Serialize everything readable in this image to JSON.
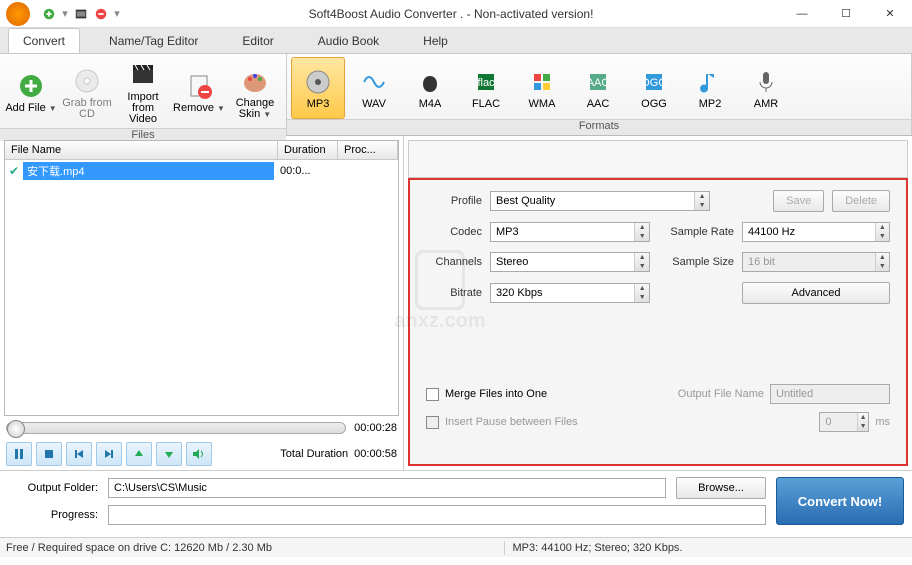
{
  "title": "Soft4Boost Audio Converter  . - Non-activated version!",
  "tabs": [
    "Convert",
    "Name/Tag Editor",
    "Editor",
    "Audio Book",
    "Help"
  ],
  "ribbon": {
    "files_label": "Files",
    "formats_label": "Formats",
    "files": [
      {
        "label": "Add\nFile",
        "drop": true
      },
      {
        "label": "Grab\nfrom CD",
        "disabled": true
      },
      {
        "label": "Import\nfrom Video"
      },
      {
        "label": "Remove",
        "drop": true
      },
      {
        "label": "Change\nSkin",
        "drop": true
      }
    ],
    "formats": [
      {
        "label": "MP3",
        "selected": true
      },
      {
        "label": "WAV"
      },
      {
        "label": "M4A"
      },
      {
        "label": "FLAC"
      },
      {
        "label": "WMA"
      },
      {
        "label": "AAC"
      },
      {
        "label": "OGG"
      },
      {
        "label": "MP2"
      },
      {
        "label": "AMR"
      }
    ]
  },
  "file_table": {
    "cols": [
      "File Name",
      "Duration",
      "Proc..."
    ],
    "rows": [
      {
        "name": "安下载.mp4",
        "duration": "00:0...",
        "proc": ""
      }
    ]
  },
  "player": {
    "elapsed": "00:00:28",
    "total_label": "Total Duration",
    "total": "00:00:58"
  },
  "settings": {
    "profile_label": "Profile",
    "profile": "Best Quality",
    "save": "Save",
    "delete": "Delete",
    "codec_label": "Codec",
    "codec": "MP3",
    "sample_rate_label": "Sample Rate",
    "sample_rate": "44100 Hz",
    "channels_label": "Channels",
    "channels": "Stereo",
    "sample_size_label": "Sample Size",
    "sample_size": "16 bit",
    "bitrate_label": "Bitrate",
    "bitrate": "320 Kbps",
    "advanced": "Advanced",
    "merge": "Merge Files into One",
    "insert_pause": "Insert Pause between Files",
    "pause_val": "0",
    "pause_unit": "ms",
    "output_file_label": "Output File Name",
    "output_file": "Untitled"
  },
  "bottom": {
    "output_folder_label": "Output Folder:",
    "output_folder": "C:\\Users\\CS\\Music",
    "browse": "Browse...",
    "convert": "Convert Now!",
    "progress_label": "Progress:"
  },
  "status": {
    "left": "Free / Required space on drive  C: 12620 Mb / 2.30 Mb",
    "right": "MP3: 44100  Hz; Stereo; 320 Kbps."
  }
}
